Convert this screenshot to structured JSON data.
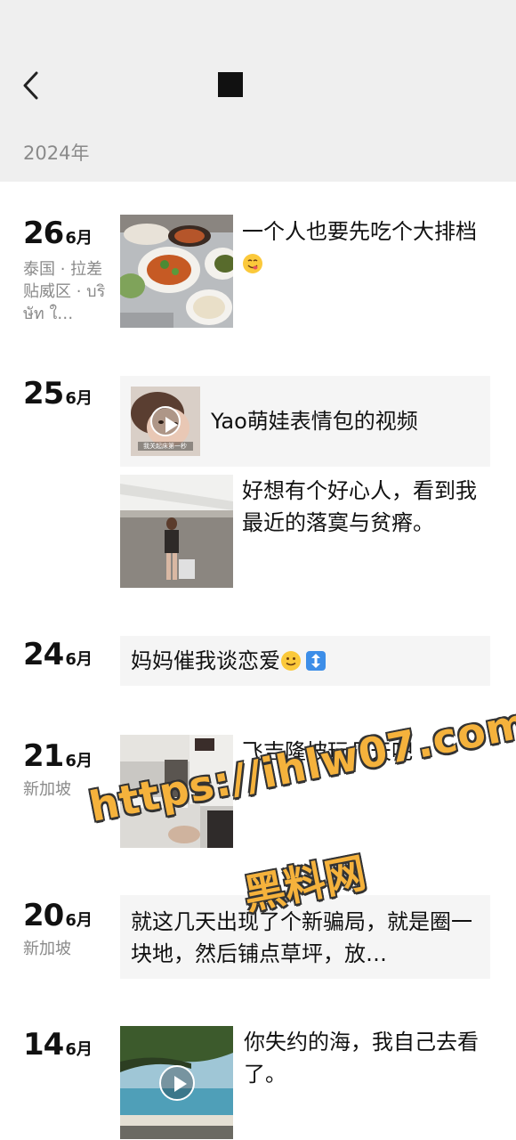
{
  "header": {
    "back_icon": "chevron-left-icon",
    "year": "2024年"
  },
  "posts": [
    {
      "day": "26",
      "month": "6月",
      "location": "泰国 · 拉差贴威区 · บริษัท ใ…",
      "text": "一个人也要先吃个大排档",
      "emoji": "yum-face-icon"
    },
    {
      "day": "25",
      "month": "6月",
      "video_title": "Yao萌娃表情包的视频",
      "video_thumb_caption": "我关起床第一秒",
      "text": "好想有个好心人，看到我最近的落寞与贫瘠。"
    },
    {
      "day": "24",
      "month": "6月",
      "text": "妈妈催我谈恋爱",
      "emoji": [
        "slight-smile-icon",
        "up-down-arrow-icon"
      ]
    },
    {
      "day": "21",
      "month": "6月",
      "location": "新加坡",
      "text": "飞吉隆坡玩几天吧"
    },
    {
      "day": "20",
      "month": "6月",
      "location": "新加坡",
      "text": "就这几天出现了个新骗局，就是圈一块地，然后铺点草坪，放…"
    },
    {
      "day": "14",
      "month": "6月",
      "text": "你失约的海，我自己去看了。"
    }
  ],
  "watermark": {
    "line1": "https://ihlw07.com",
    "line2": "黑料网"
  }
}
